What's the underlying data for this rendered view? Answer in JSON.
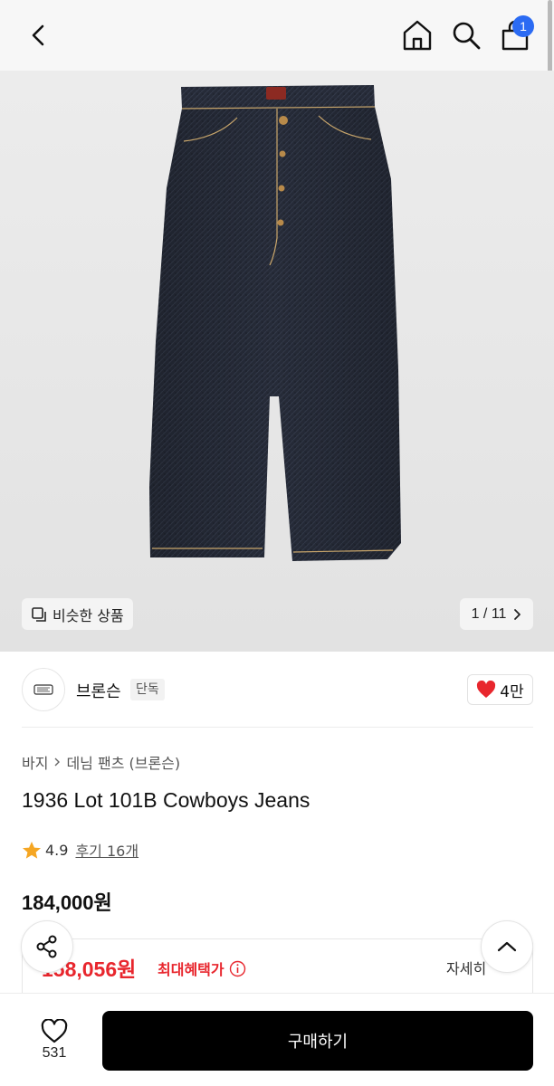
{
  "header": {
    "cart_count": "1",
    "icons": [
      "back-arrow-icon",
      "home-icon",
      "search-icon",
      "cart-icon"
    ]
  },
  "gallery": {
    "similar_label": "비슷한 상품",
    "pager_text": "1 / 11"
  },
  "brand": {
    "name": "브론슨",
    "tag": "단독",
    "like_count": "4만"
  },
  "product": {
    "breadcrumb": [
      "바지",
      "데님 팬츠 (브론슨)"
    ],
    "title": "1936 Lot 101B Cowboys Jeans",
    "rating": "4.9",
    "reviews": "후기 16개",
    "price": "184,000원",
    "benefit_price": "158,056원",
    "benefit_label": "최대혜택가",
    "benefit_detail": "자세히"
  },
  "bottom": {
    "wish_count": "531",
    "buy_label": "구매하기"
  },
  "colors": {
    "accent_red": "#e8262d",
    "badge_blue": "#2b6bf3",
    "buy_button": "#000000"
  }
}
